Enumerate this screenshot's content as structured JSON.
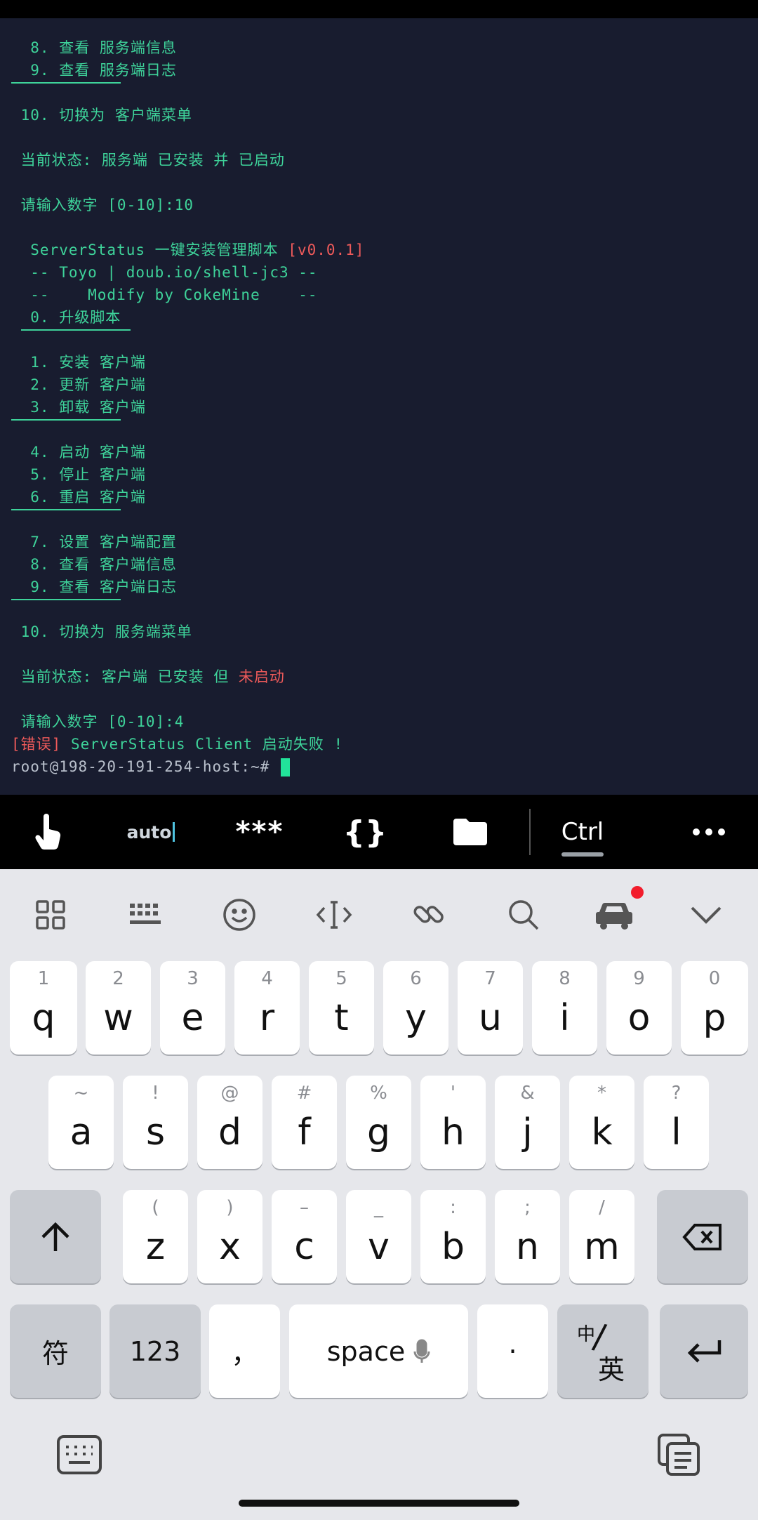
{
  "terminal": {
    "lines": [
      {
        "text": "  8. 查看 服务端信息"
      },
      {
        "text": "  9. 查看 服务端日志"
      },
      {
        "text": " 10. 切换为 客户端菜单"
      },
      {
        "text": " 当前状态: 服务端 已安装 并 已启动"
      },
      {
        "text": " 请输入数字 [0-10]:10"
      },
      {
        "text": "  ServerStatus 一键安装管理脚本 ",
        "tag": "[v0.0.1]"
      },
      {
        "text": "  -- Toyo | doub.io/shell-jc3 --"
      },
      {
        "text": "  --    Modify by CokeMine    --"
      },
      {
        "text": "  0. 升级脚本"
      },
      {
        "text": "  1. 安装 客户端"
      },
      {
        "text": "  2. 更新 客户端"
      },
      {
        "text": "  3. 卸载 客户端"
      },
      {
        "text": "  4. 启动 客户端"
      },
      {
        "text": "  5. 停止 客户端"
      },
      {
        "text": "  6. 重启 客户端"
      },
      {
        "text": "  7. 设置 客户端配置"
      },
      {
        "text": "  8. 查看 客户端信息"
      },
      {
        "text": "  9. 查看 客户端日志"
      },
      {
        "text": " 10. 切换为 服务端菜单"
      },
      {
        "text": " 当前状态: 客户端 已安装 但 ",
        "red": "未启动"
      },
      {
        "text": " 请输入数字 [0-10]:4"
      },
      {
        "red_prefix": "[错误]",
        "text": " ServerStatus Client 启动失败 !"
      },
      {
        "prompt": "root@198-20-191-254-host:~# "
      }
    ]
  },
  "toolbar": {
    "items": [
      {
        "icon": "touch-hand-icon"
      },
      {
        "label": "auto"
      },
      {
        "label": "***"
      },
      {
        "label": "{}"
      },
      {
        "icon": "folder-icon"
      },
      {
        "label": "Ctrl"
      },
      {
        "icon": "more-dots-icon"
      }
    ]
  },
  "keyboard": {
    "toolbar_icons": [
      "apps-grid-icon",
      "keyboard-layout-icon",
      "emoji-icon",
      "cursor-move-icon",
      "link-icon",
      "search-icon",
      "car-mode-icon",
      "collapse-chevron-icon"
    ],
    "row1": [
      {
        "hint": "1",
        "key": "q"
      },
      {
        "hint": "2",
        "key": "w"
      },
      {
        "hint": "3",
        "key": "e"
      },
      {
        "hint": "4",
        "key": "r"
      },
      {
        "hint": "5",
        "key": "t"
      },
      {
        "hint": "6",
        "key": "y"
      },
      {
        "hint": "7",
        "key": "u"
      },
      {
        "hint": "8",
        "key": "i"
      },
      {
        "hint": "9",
        "key": "o"
      },
      {
        "hint": "0",
        "key": "p"
      }
    ],
    "row2": [
      {
        "hint": "~",
        "key": "a"
      },
      {
        "hint": "!",
        "key": "s"
      },
      {
        "hint": "@",
        "key": "d"
      },
      {
        "hint": "#",
        "key": "f"
      },
      {
        "hint": "%",
        "key": "g"
      },
      {
        "hint": "'",
        "key": "h"
      },
      {
        "hint": "&",
        "key": "j"
      },
      {
        "hint": "*",
        "key": "k"
      },
      {
        "hint": "?",
        "key": "l"
      }
    ],
    "row3": [
      {
        "hint": "(",
        "key": "z"
      },
      {
        "hint": ")",
        "key": "x"
      },
      {
        "hint": "–",
        "key": "c"
      },
      {
        "hint": "_",
        "key": "v"
      },
      {
        "hint": ":",
        "key": "b"
      },
      {
        "hint": ";",
        "key": "n"
      },
      {
        "hint": "/",
        "key": "m"
      }
    ],
    "row4": {
      "symbols": "符",
      "numbers": "123",
      "comma": "，",
      "space": "space",
      "period": "·",
      "lang_top": "中",
      "lang_bottom": "英"
    }
  }
}
